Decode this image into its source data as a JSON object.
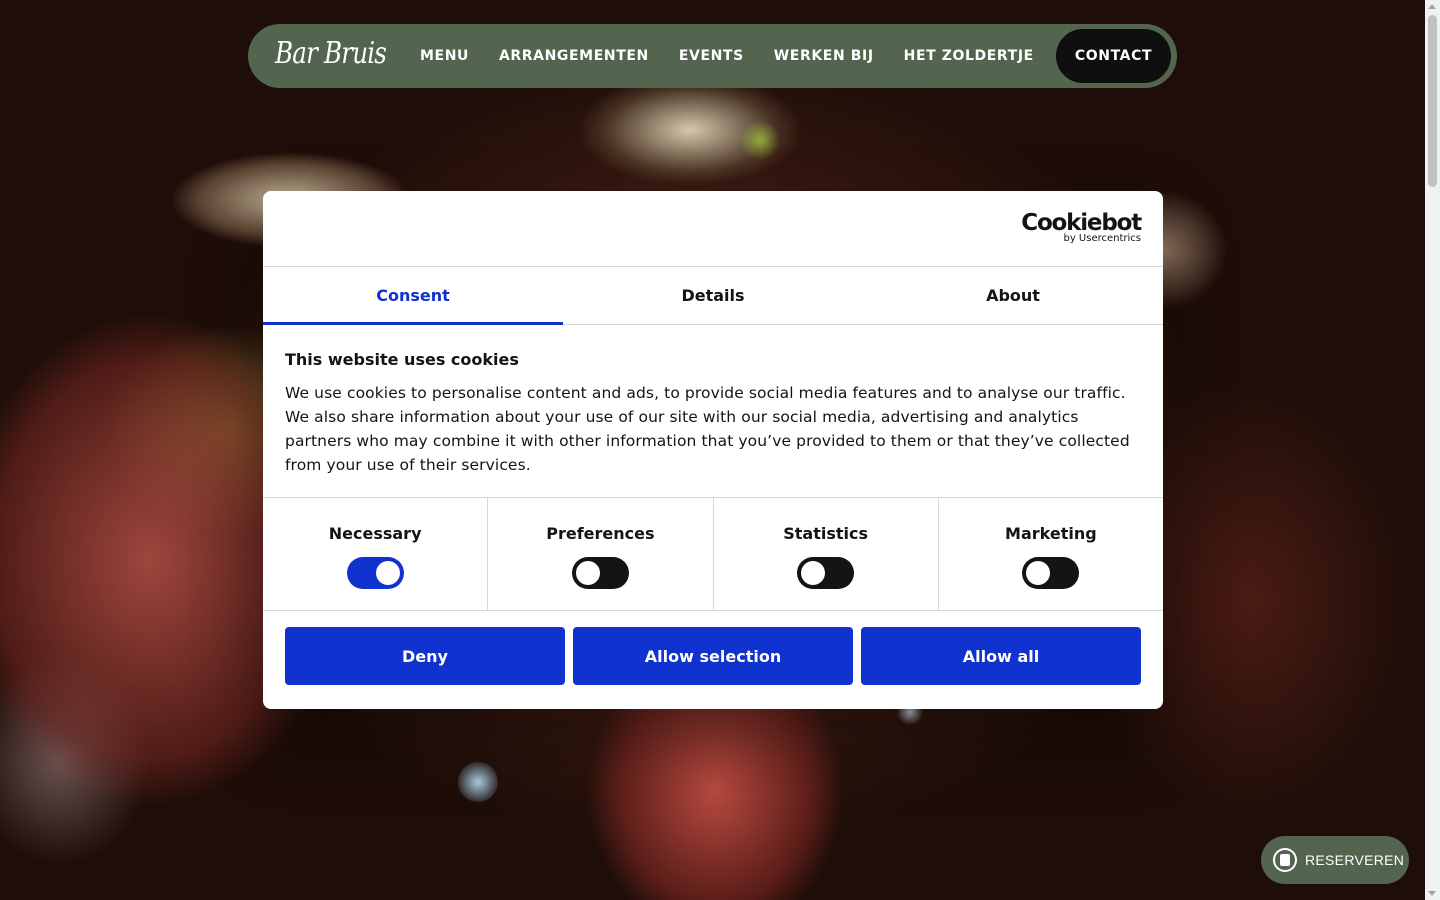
{
  "site": {
    "logo_text": "Bar Bruis",
    "nav": {
      "items": [
        {
          "label": "MENU"
        },
        {
          "label": "ARRANGEMENTEN"
        },
        {
          "label": "EVENTS"
        },
        {
          "label": "WERKEN BIJ"
        },
        {
          "label": "HET ZOLDERTJE"
        }
      ],
      "contact_label": "CONTACT"
    },
    "reserve_label": "RESERVEREN",
    "colors": {
      "nav_bg": "#53654f",
      "contact_bg": "#0f0f0f"
    }
  },
  "cookie_dialog": {
    "brand": {
      "name": "Cookiebot",
      "sub": "by Usercentrics"
    },
    "tabs": [
      {
        "label": "Consent",
        "active": true
      },
      {
        "label": "Details",
        "active": false
      },
      {
        "label": "About",
        "active": false
      }
    ],
    "title": "This website uses cookies",
    "description": "We use cookies to personalise content and ads, to provide social media features and to analyse our traffic. We also share information about your use of our site with our social media, advertising and analytics partners who may combine it with other information that you’ve provided to them or that they’ve collected from your use of their services.",
    "categories": [
      {
        "label": "Necessary",
        "enabled": true
      },
      {
        "label": "Preferences",
        "enabled": false
      },
      {
        "label": "Statistics",
        "enabled": false
      },
      {
        "label": "Marketing",
        "enabled": false
      }
    ],
    "buttons": {
      "deny": "Deny",
      "allow_selection": "Allow selection",
      "allow_all": "Allow all"
    },
    "colors": {
      "accent": "#1032cf"
    }
  }
}
